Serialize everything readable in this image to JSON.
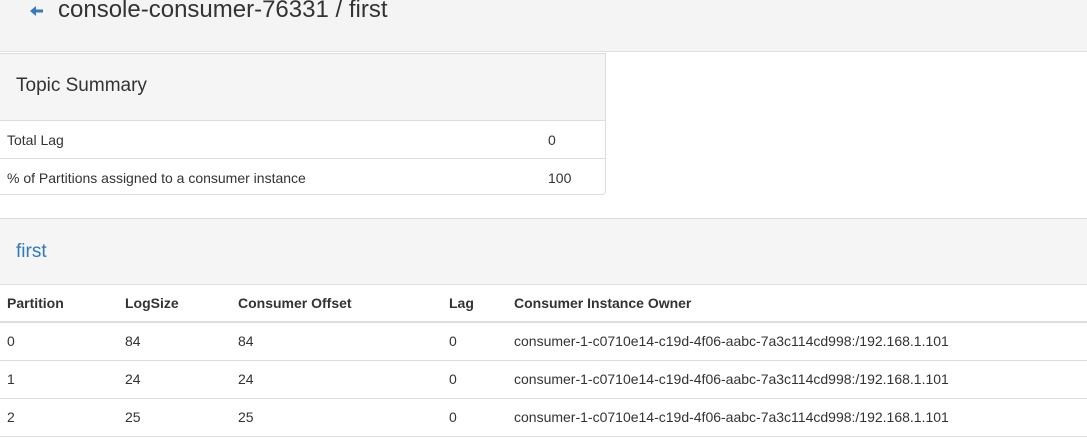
{
  "header": {
    "back_icon": "arrow-left-icon",
    "title": "console-consumer-76331 / first"
  },
  "topic_summary": {
    "title": "Topic Summary",
    "rows": [
      {
        "label": "Total Lag",
        "value": "0"
      },
      {
        "label": "% of Partitions assigned to a consumer instance",
        "value": "100"
      }
    ]
  },
  "topic_panel": {
    "title": "first",
    "columns": [
      "Partition",
      "LogSize",
      "Consumer Offset",
      "Lag",
      "Consumer Instance Owner"
    ],
    "rows": [
      {
        "partition": "0",
        "logsize": "84",
        "offset": "84",
        "lag": "0",
        "owner": "consumer-1-c0710e14-c19d-4f06-aabc-7a3c114cd998:/192.168.1.101"
      },
      {
        "partition": "1",
        "logsize": "24",
        "offset": "24",
        "lag": "0",
        "owner": "consumer-1-c0710e14-c19d-4f06-aabc-7a3c114cd998:/192.168.1.101"
      },
      {
        "partition": "2",
        "logsize": "25",
        "offset": "25",
        "lag": "0",
        "owner": "consumer-1-c0710e14-c19d-4f06-aabc-7a3c114cd998:/192.168.1.101"
      }
    ]
  },
  "colors": {
    "link": "#337ab7",
    "panel_heading": "#f5f5f5",
    "border": "#dddddd"
  }
}
